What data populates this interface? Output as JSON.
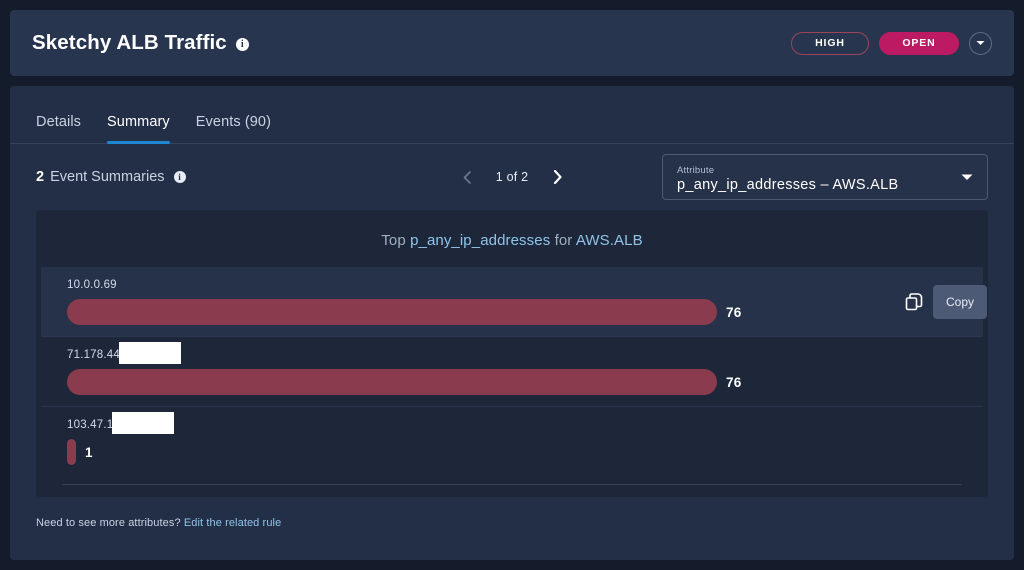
{
  "header": {
    "title": "Sketchy ALB Traffic",
    "info_icon": "info-icon",
    "severity_badge": "HIGH",
    "status_badge": "OPEN",
    "severity_color": "#9e4458",
    "status_color": "#bc1b64",
    "caret_icon": "chevron-down-icon"
  },
  "tabs": [
    {
      "label": "Details",
      "active": false
    },
    {
      "label": "Summary",
      "active": true
    },
    {
      "label": "Events (90)",
      "active": false
    }
  ],
  "toolbar": {
    "count": "2",
    "summaries_label": "Event Summaries",
    "info_icon": "info-icon",
    "pager": {
      "prev_icon": "chevron-left-icon",
      "next_icon": "chevron-right-icon",
      "text": "1 of 2",
      "current_page": 1,
      "total_pages": 2,
      "prev_disabled": true
    },
    "attribute_select": {
      "label": "Attribute",
      "value": "p_any_ip_addresses – AWS.ALB",
      "caret_icon": "chevron-down-icon"
    }
  },
  "chart_data": {
    "type": "bar",
    "title_prefix": "Top",
    "title_attribute": "p_any_ip_addresses",
    "title_connector": "for",
    "title_source": "AWS.ALB",
    "title": "Top p_any_ip_addresses for AWS.ALB",
    "orientation": "horizontal",
    "xlabel": "",
    "ylabel": "",
    "bar_color": "#8a3b4e",
    "max_value": 76,
    "categories": [
      "10.0.0.69",
      "71.178.44",
      "103.47.1"
    ],
    "values": [
      76,
      76,
      1
    ],
    "bars": [
      {
        "label": "10.0.0.69",
        "value": 76,
        "redacted": false,
        "redaction_width": 0,
        "hovered": true
      },
      {
        "label": "71.178.44",
        "value": 76,
        "redacted": true,
        "redaction_width": 62,
        "hovered": false
      },
      {
        "label": "103.47.1",
        "value": 1,
        "redacted": true,
        "redaction_width": 62,
        "hovered": false
      }
    ]
  },
  "copy_action": {
    "icon": "copy-icon",
    "tooltip": "Copy"
  },
  "footer": {
    "text": "Need to see more attributes?",
    "link": "Edit the related rule"
  }
}
